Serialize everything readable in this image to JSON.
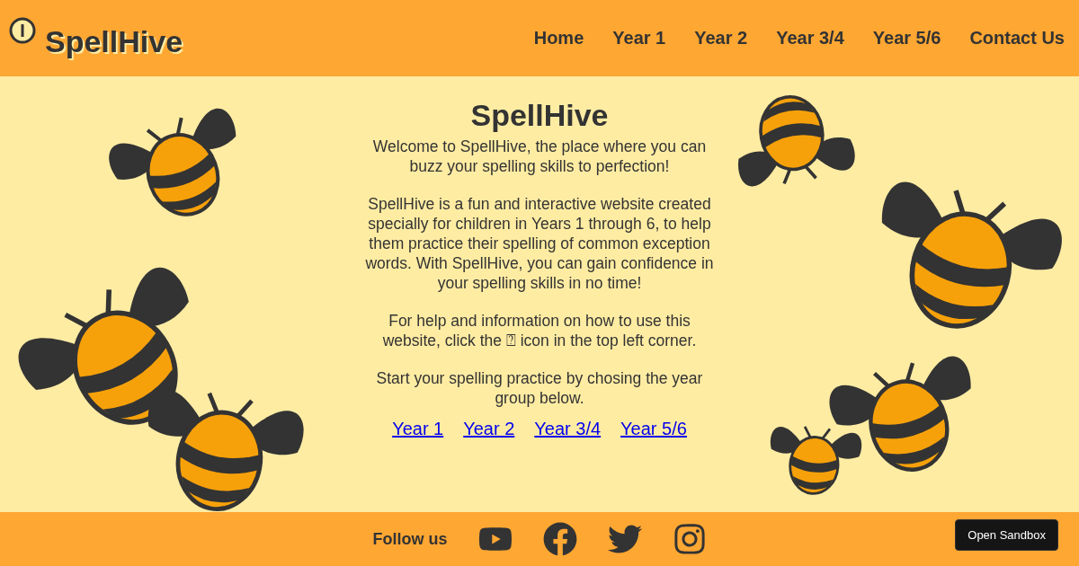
{
  "header": {
    "logo": "SpellHive",
    "nav": [
      {
        "label": "Home"
      },
      {
        "label": "Year 1"
      },
      {
        "label": "Year 2"
      },
      {
        "label": "Year 3/4"
      },
      {
        "label": "Year 5/6"
      },
      {
        "label": "Contact Us"
      }
    ]
  },
  "main": {
    "title": "SpellHive",
    "paragraphs": [
      "Welcome to SpellHive, the place where you can buzz your spelling skills to perfection!",
      "SpellHive is a fun and interactive website created specially for children in Years 1 through 6, to help them practice their spelling of common exception words. With SpellHive, you can gain confidence in your spelling skills in no time!",
      "For help and information on how to use this website, click the ⍰ icon in the top left corner.",
      "Start your spelling practice by chosing the year group below."
    ],
    "links": [
      "Year 1",
      "Year 2",
      "Year 3/4",
      "Year 5/6"
    ]
  },
  "footer": {
    "follow": "Follow us",
    "sandbox": "Open Sandbox"
  }
}
